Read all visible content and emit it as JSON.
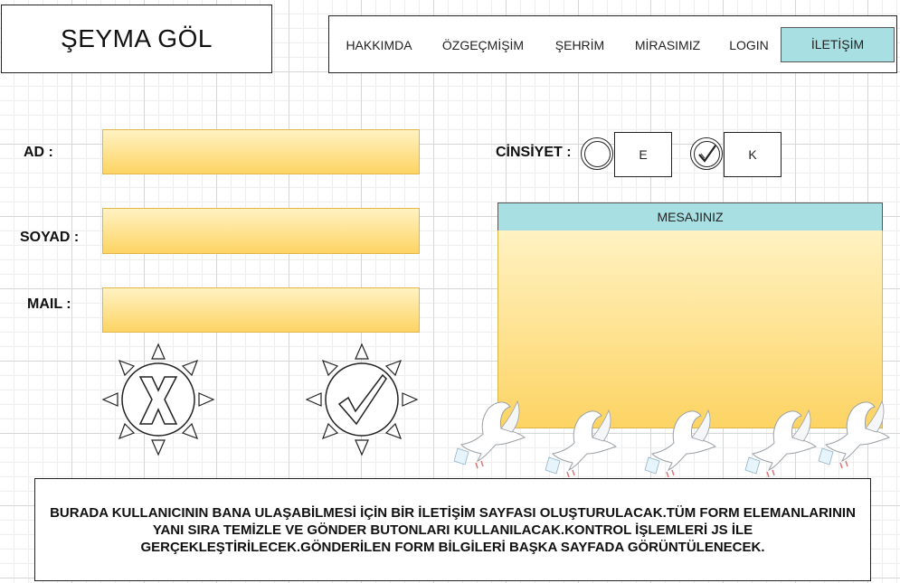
{
  "header": {
    "logo_text": "ŞEYMA GÖL"
  },
  "nav": {
    "items": [
      {
        "label": "HAKKIMDA"
      },
      {
        "label": "ÖZGEÇMİŞİM"
      },
      {
        "label": "ŞEHRİM"
      },
      {
        "label": "MİRASIMIZ"
      },
      {
        "label": "LOGIN"
      },
      {
        "label": "İLETİŞİM",
        "active": true
      }
    ],
    "active_color": "#a8dfe2"
  },
  "form": {
    "name_label": "AD :",
    "surname_label": "SOYAD :",
    "mail_label": "MAIL :",
    "field_color": "#fdd464"
  },
  "gender": {
    "label": "CİNSİYET :",
    "options": [
      {
        "label": "E",
        "checked": false
      },
      {
        "label": "K",
        "checked": true
      }
    ]
  },
  "message": {
    "header": "MESAJINIZ"
  },
  "buttons": {
    "clear_icon": "x-sun-icon",
    "send_icon": "check-sun-icon"
  },
  "note": {
    "text": "BURADA KULLANICININ BANA ULAŞABİLMESİ İÇİN BİR İLETİŞİM SAYFASI OLUŞTURULACAK.TÜM FORM ELEMANLARININ YANI SIRA TEMİZLE VE GÖNDER BUTONLARI KULLANILACAK.KONTROL İŞLEMLERİ JS İLE GERÇEKLEŞTİRİLECEK.GÖNDERİLEN FORM BİLGİLERİ BAŞKA SAYFADA GÖRÜNTÜLENECEK."
  },
  "decor": {
    "dove_icon": "dove-icon",
    "dove_count": 5
  }
}
